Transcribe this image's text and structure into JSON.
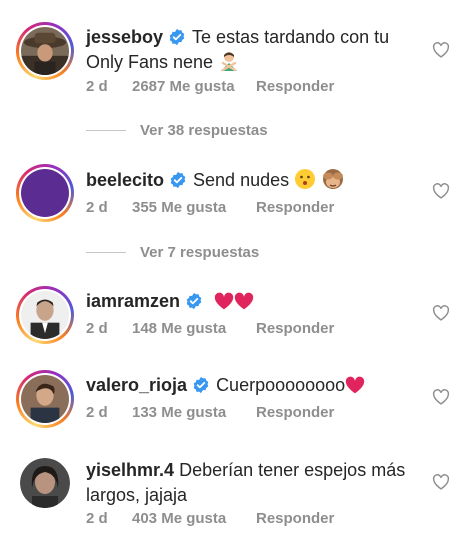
{
  "comments": [
    {
      "username": "jesseboy",
      "verified": true,
      "text": "Te estas tardando con tu Only Fans nene",
      "emoji": "person-gesturing-no",
      "age": "2 d",
      "likes": "2687 Me gusta",
      "reply_label": "Responder",
      "view_replies": "Ver 38 respuestas"
    },
    {
      "username": "beelecito",
      "verified": true,
      "text": "Send nudes",
      "emoji": "kissing-face, see-no-evil-monkey",
      "age": "2 d",
      "likes": "355 Me gusta",
      "reply_label": "Responder",
      "view_replies": "Ver 7 respuestas"
    },
    {
      "username": "iamramzen",
      "verified": true,
      "text": "",
      "emoji": "red-heart, red-heart",
      "age": "2 d",
      "likes": "148 Me gusta",
      "reply_label": "Responder"
    },
    {
      "username": "valero_rioja",
      "verified": true,
      "text": "Cuerpoooooooo",
      "emoji": "red-heart",
      "age": "2 d",
      "likes": "133 Me gusta",
      "reply_label": "Responder"
    },
    {
      "username": "yiselhmr.4",
      "verified": false,
      "text": "Deberían tener espejos más largos, jajaja",
      "age": "2 d",
      "likes": "403 Me gusta",
      "reply_label": "Responder"
    }
  ],
  "colors": {
    "verified": "#3897f0",
    "muted": "#8e8e8e",
    "heart": "#e0245e"
  }
}
